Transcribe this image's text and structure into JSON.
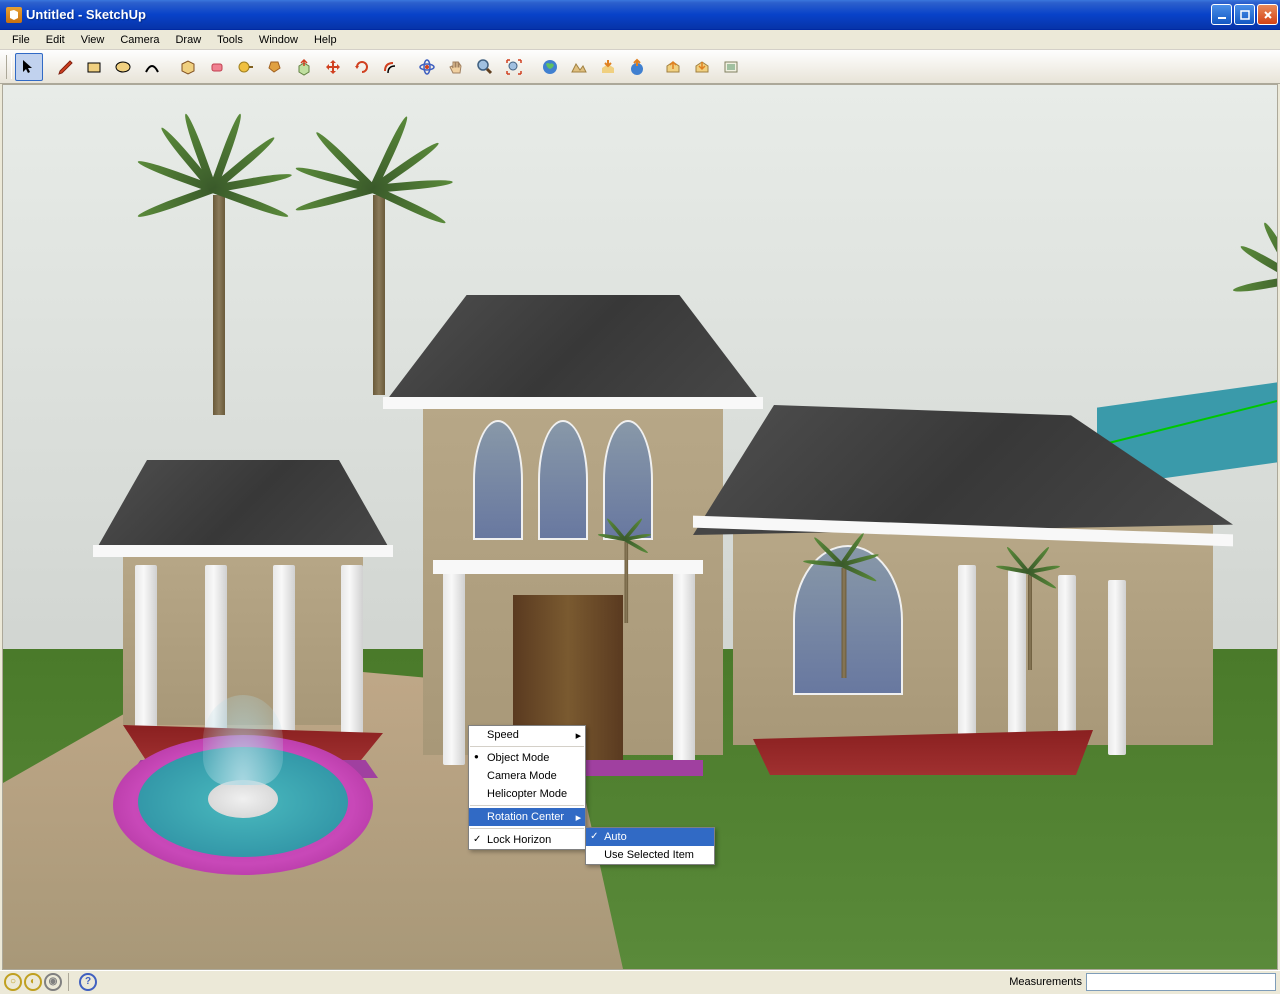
{
  "window": {
    "title": "Untitled - SketchUp"
  },
  "menubar": {
    "items": [
      "File",
      "Edit",
      "View",
      "Camera",
      "Draw",
      "Tools",
      "Window",
      "Help"
    ]
  },
  "toolbar": {
    "tools": [
      {
        "name": "select-tool",
        "active": true
      },
      {
        "name": "line-tool"
      },
      {
        "name": "rectangle-tool"
      },
      {
        "name": "circle-tool"
      },
      {
        "name": "arc-tool"
      },
      {
        "sep": true
      },
      {
        "name": "make-component-tool"
      },
      {
        "name": "eraser-tool"
      },
      {
        "name": "tape-measure-tool"
      },
      {
        "name": "paint-bucket-tool"
      },
      {
        "name": "push-pull-tool"
      },
      {
        "name": "move-tool"
      },
      {
        "name": "rotate-tool"
      },
      {
        "name": "offset-tool"
      },
      {
        "sep": true
      },
      {
        "name": "orbit-tool"
      },
      {
        "name": "pan-tool"
      },
      {
        "name": "zoom-tool"
      },
      {
        "name": "zoom-extents-tool"
      },
      {
        "sep": true
      },
      {
        "name": "get-current-view-tool"
      },
      {
        "name": "toggle-terrain-tool"
      },
      {
        "name": "place-model-tool"
      },
      {
        "name": "get-models-tool"
      },
      {
        "name": "share-model-tool"
      },
      {
        "name": "export-tool"
      },
      {
        "name": "preview-tool"
      }
    ]
  },
  "context_menu": {
    "items": [
      {
        "label": "Speed",
        "has_submenu": true
      },
      {
        "sep": true
      },
      {
        "label": "Object Mode",
        "radio": true
      },
      {
        "label": "Camera Mode"
      },
      {
        "label": "Helicopter Mode"
      },
      {
        "sep": true
      },
      {
        "label": "Rotation Center",
        "has_submenu": true,
        "highlighted": true
      },
      {
        "sep": true
      },
      {
        "label": "Lock Horizon",
        "checked": true
      }
    ],
    "submenu": {
      "items": [
        {
          "label": "Auto",
          "checked": true,
          "highlighted": true
        },
        {
          "label": "Use Selected Item"
        }
      ]
    }
  },
  "statusbar": {
    "measurements_label": "Measurements"
  }
}
